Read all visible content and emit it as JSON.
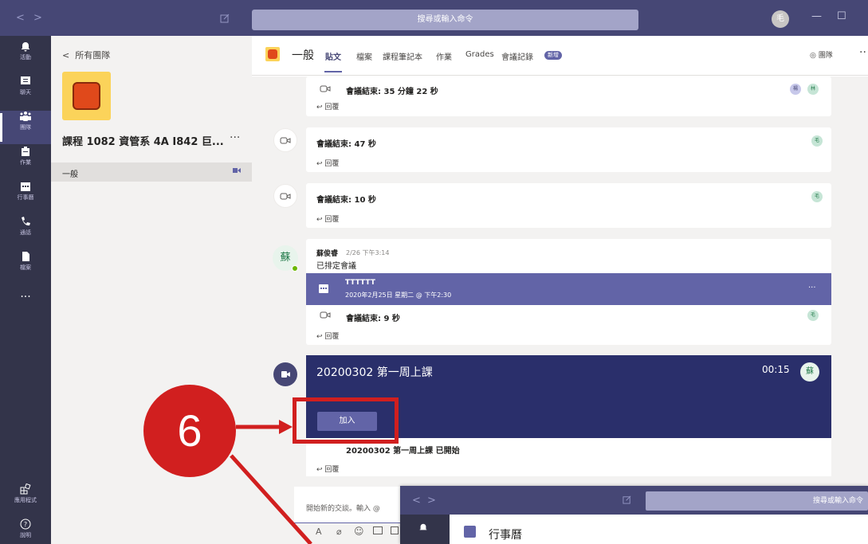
{
  "topbar": {
    "search_placeholder": "搜尋或輸入命令",
    "avatar": "毛"
  },
  "appbar": {
    "items": [
      {
        "label": "活動",
        "icon": "bell-icon"
      },
      {
        "label": "聊天",
        "icon": "chat-icon"
      },
      {
        "label": "團隊",
        "icon": "teams-icon"
      },
      {
        "label": "作業",
        "icon": "assignments-icon"
      },
      {
        "label": "行事曆",
        "icon": "calendar-icon"
      },
      {
        "label": "通話",
        "icon": "phone-icon"
      },
      {
        "label": "檔案",
        "icon": "files-icon"
      }
    ],
    "more": "···",
    "apps_label": "應用程式",
    "help_label": "說明"
  },
  "teampane": {
    "back": "所有團隊",
    "team_name": "課程 1082 資管系 4A I842 巨...",
    "more": "···",
    "channel": "一般"
  },
  "channel": {
    "title": "一般",
    "tabs": [
      "貼文",
      "檔案",
      "課程筆記本",
      "作業",
      "Grades",
      "會議記錄"
    ],
    "badge": "新增",
    "team_button": "◎ 團隊",
    "more": "··"
  },
  "feed": {
    "m1": {
      "text": "會議結束: 35 分鐘 22 秒",
      "reply": "回覆",
      "av1": "楊",
      "av2": "林"
    },
    "m2": {
      "text": "會議結束: 47 秒",
      "reply": "回覆",
      "av": "毛"
    },
    "m3": {
      "text": "會議結束: 10 秒",
      "reply": "回覆",
      "av": "毛"
    },
    "post": {
      "author": "蘇俊睿",
      "time": "2/26 下午3:14",
      "body": "已排定會議",
      "avatar": "蘇",
      "event_title": "TTTTTT",
      "event_time": "2020年2月25日 星期二 @ 下午2:30",
      "event_more": "···",
      "ended": "會議結束: 9 秒",
      "av": "毛",
      "reply": "回覆"
    },
    "live": {
      "title": "20200302 第一周上課",
      "time": "00:15",
      "avatar": "蘇",
      "join": "加入",
      "started": "20200302 第一周上課 已開始",
      "reply": "回覆"
    }
  },
  "compose": {
    "placeholder": "開始新的交談。輸入 @"
  },
  "annotation": {
    "number": "6",
    "color": "#d11f1f"
  },
  "overlay": {
    "search": "搜尋或輸入命令",
    "title": "行事曆"
  },
  "colors": {
    "purple": "#6264a7",
    "dark": "#33344a",
    "navy": "#2a2f6b"
  }
}
